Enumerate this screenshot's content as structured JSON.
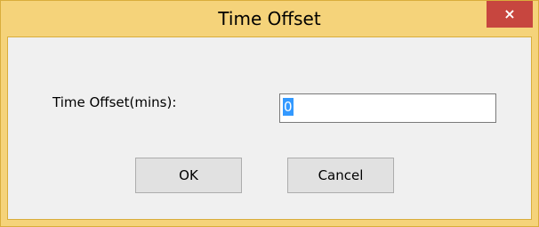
{
  "window": {
    "title": "Time Offset",
    "close_glyph": "×",
    "close_icon": "close-icon"
  },
  "form": {
    "label": "Time Offset(mins):",
    "value": "0"
  },
  "buttons": {
    "ok": "OK",
    "cancel": "Cancel"
  },
  "colors": {
    "frame": "#f5d37a",
    "close_button": "#c7463f",
    "client_bg": "#f0f0f0",
    "selection": "#3399ff"
  }
}
